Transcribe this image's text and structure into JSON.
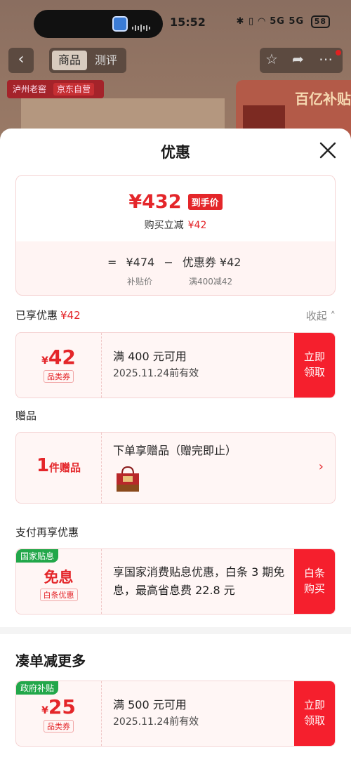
{
  "status_bar": {
    "time": "15:52",
    "battery": "58",
    "signal": "5G 5G"
  },
  "nav": {
    "tab_product": "商品",
    "tab_review": "测评"
  },
  "background": {
    "brand_tag": "泸州老窖",
    "brand_tag_sub": "京东自营",
    "promo_text": "百亿补贴"
  },
  "sheet": {
    "title": "优惠",
    "price_card": {
      "final_price": "¥432",
      "final_badge": "到手价",
      "reduce_label": "购买立减",
      "reduce_amount": "¥42",
      "formula_eq": "=",
      "subsidy_price": "¥474",
      "formula_minus": "−",
      "coupon_formula": "优惠券 ¥42",
      "subsidy_label": "补贴价",
      "coupon_rule": "满400减42"
    },
    "enjoyed": {
      "label": "已享优惠",
      "amount": "¥42",
      "collapse": "收起"
    },
    "coupon1": {
      "symbol": "¥",
      "amount": "42",
      "tag": "品类券",
      "title": "满 400 元可用",
      "validity": "2025.11.24前有效",
      "button": "立即领取"
    },
    "gift_section": {
      "label": "赠品"
    },
    "gift": {
      "count": "1",
      "unit": "件赠品",
      "title": "下单享赠品（赠完即止）"
    },
    "pay_section": {
      "label": "支付再享优惠"
    },
    "pay_coupon": {
      "green_tag": "国家贴息",
      "amount": "免息",
      "tag": "白条优惠",
      "text": "享国家消费贴息优惠，白条 3 期免息，最高省息费 22.8 元",
      "button": "白条购买"
    },
    "more_section": {
      "label": "凑单减更多"
    },
    "coupon2": {
      "green_tag": "政府补贴",
      "symbol": "¥",
      "amount": "25",
      "tag": "品类券",
      "title": "满 500 元可用",
      "validity": "2025.11.24前有效",
      "button": "立即领取"
    }
  },
  "colors": {
    "accent_red": "#e4262a",
    "button_red": "#f51f2d",
    "tag_green": "#22a74a"
  }
}
